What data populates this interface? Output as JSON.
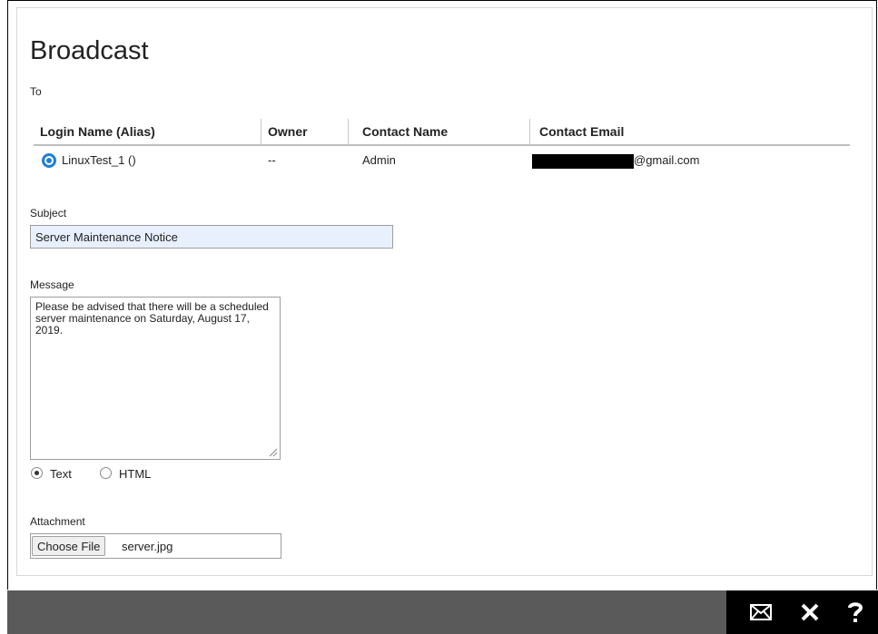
{
  "page": {
    "title": "Broadcast",
    "to_label": "To"
  },
  "recipients_table": {
    "headers": {
      "login": "Login Name (Alias)",
      "owner": "Owner",
      "contact_name": "Contact Name",
      "contact_email": "Contact Email"
    },
    "rows": [
      {
        "login": "LinuxTest_1 ()",
        "owner": "--",
        "contact_name": "Admin",
        "contact_email_suffix": "@gmail.com"
      }
    ]
  },
  "subject": {
    "label": "Subject",
    "value": "Server Maintenance Notice"
  },
  "message": {
    "label": "Message",
    "value": "Please be advised that there will be a scheduled server maintenance on Saturday, August 17, 2019."
  },
  "format": {
    "options": [
      "Text",
      "HTML"
    ],
    "selected": "Text"
  },
  "attachment": {
    "label": "Attachment",
    "button_label": "Choose File",
    "file_name": "server.jpg"
  },
  "footer": {
    "actions": [
      "mail-icon",
      "close-icon",
      "help-icon"
    ]
  },
  "colors": {
    "accent": "#1e7fd4",
    "footer_bg": "#5a5a5a",
    "footer_actions_bg": "#000000",
    "input_autofill_bg": "#e8f0fe"
  }
}
